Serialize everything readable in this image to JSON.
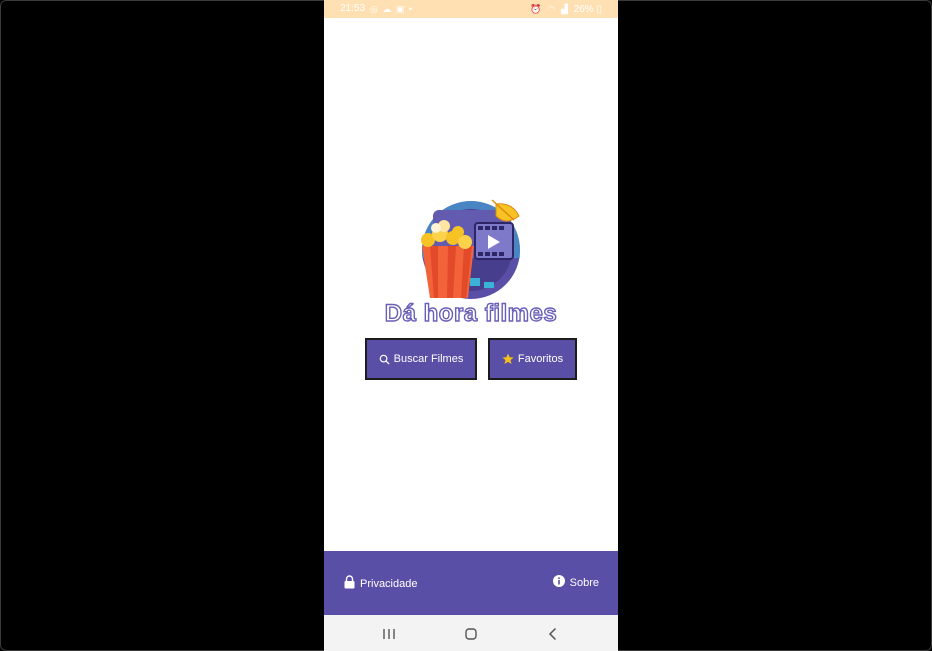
{
  "status_bar": {
    "time": "21:53",
    "left_icons": [
      "whatsapp-icon",
      "cloud-icon",
      "gallery-icon",
      "dot-icon"
    ],
    "right_icons": [
      "alarm-icon",
      "wifi-icon",
      "signal-icon"
    ],
    "battery": "26%"
  },
  "logo": {
    "title": "Dá hora filmes"
  },
  "buttons": {
    "search_label": "Buscar Filmes",
    "search_icon": "search-icon",
    "favorites_label": "Favoritos",
    "favorites_icon": "star-icon"
  },
  "footer": {
    "privacy_label": "Privacidade",
    "privacy_icon": "lock-icon",
    "about_label": "Sobre",
    "about_icon": "info-icon"
  },
  "nav": {
    "items": [
      "recent-apps",
      "home",
      "back"
    ]
  },
  "colors": {
    "status_bar": "#ffe0b2",
    "primary": "#5a4fa6",
    "nav_bar": "#f3f3f3",
    "star": "#f6c21a"
  }
}
